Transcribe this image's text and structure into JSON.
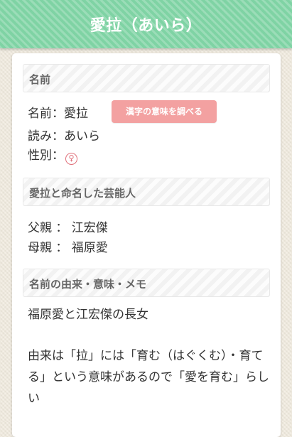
{
  "header": {
    "title": "愛拉（あいら）"
  },
  "sections": {
    "name": {
      "title": "名前",
      "name_line": "名前：愛拉",
      "reading_line": "読み：あいら",
      "gender_label": "性別：",
      "gender_icon": "female-icon",
      "kanji_button": "漢字の意味を調べる"
    },
    "celebrities": {
      "title": "愛拉と命名した芸能人",
      "father": "父親 ： 江宏傑",
      "mother": "母親 ： 福原愛"
    },
    "origin": {
      "title": "名前の由来・意味・メモ",
      "memo_line1": "福原愛と江宏傑の長女",
      "memo_line2": "由来は「拉」には「育む（はぐくむ）・育てる」という意味があるので「愛を育む」らしい"
    }
  },
  "colors": {
    "header_green": "#7fd3a4",
    "button_pink": "#f3a1a1",
    "female_icon": "#e0707a"
  }
}
